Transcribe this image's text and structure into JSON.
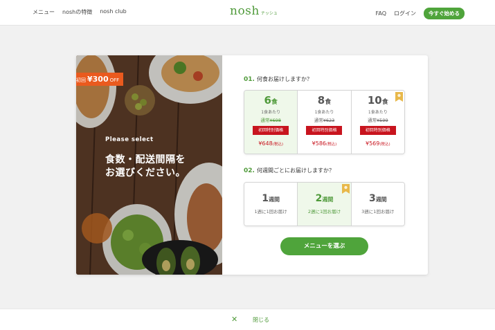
{
  "header": {
    "nav_left": [
      "メニュー",
      "noshの特徴",
      "nosh club"
    ],
    "logo": "nosh",
    "logo_sub": "ナッシュ",
    "faq": "FAQ",
    "login": "ログイン",
    "start": "今すぐ始める"
  },
  "promo": {
    "badge_prefix": "初回",
    "badge_amount": "¥300",
    "badge_suffix": "OFF",
    "please_select": "Please select",
    "headline": "食数・配送間隔を\nお選びください。"
  },
  "q1": {
    "num": "01.",
    "label": "何食お届けしますか？",
    "options": [
      {
        "count": "6",
        "unit": "食",
        "per": "1食あたり",
        "normal_prefix": "通常",
        "normal_price": "¥698",
        "special": "初回特別価格",
        "price": "¥648",
        "tax": "(税込)"
      },
      {
        "count": "8",
        "unit": "食",
        "per": "1食あたり",
        "normal_prefix": "通常",
        "normal_price": "¥623",
        "special": "初回特別価格",
        "price": "¥586",
        "tax": "(税込)"
      },
      {
        "count": "10",
        "unit": "食",
        "per": "1食あたり",
        "normal_prefix": "通常",
        "normal_price": "¥599",
        "special": "初回特別価格",
        "price": "¥569",
        "tax": "(税込)"
      }
    ],
    "selected_index": 0
  },
  "q2": {
    "num": "02.",
    "label": "何週間ごとにお届けしますか？",
    "options": [
      {
        "count": "1",
        "unit": "週間",
        "freq": "1週に1回お届け"
      },
      {
        "count": "2",
        "unit": "週間",
        "freq": "2週に1回お届け"
      },
      {
        "count": "3",
        "unit": "週間",
        "freq": "3週に1回お届け"
      }
    ],
    "selected_index": 1
  },
  "choose_button": "メニューを選ぶ",
  "footer": {
    "close_icon": "✕",
    "close_label": "閉じる"
  },
  "colors": {
    "brand_green": "#4fa43b",
    "price_red": "#c8141e",
    "badge_orange": "#ea5a1e",
    "recommend_gold": "#e8b84a"
  }
}
